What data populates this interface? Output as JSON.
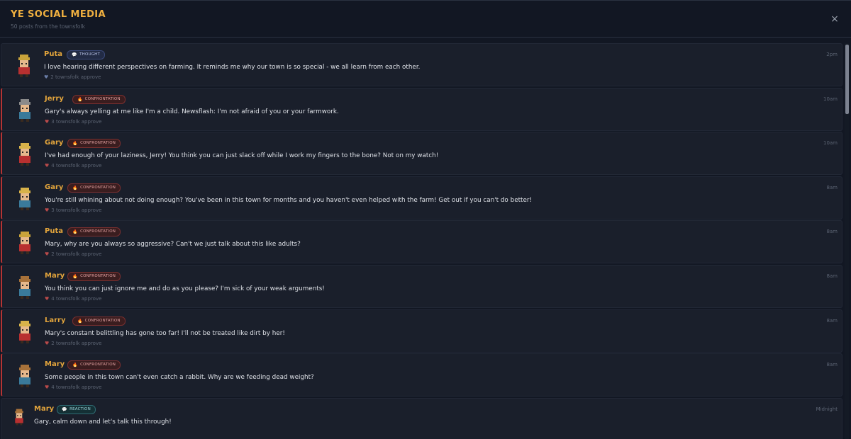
{
  "header": {
    "title": "YE SOCIAL MEDIA",
    "subtitle": "50 posts from the townsfolk",
    "close_icon": "×"
  },
  "posts": [
    {
      "name": "Puta",
      "type": "thought",
      "badge": "THOUGHT",
      "badge_icon": "💬",
      "text": "I love hearing different perspectives on farming. It reminds me why our town is so special - we all learn from each other.",
      "likes": "2 townsfolk approve",
      "time": "2pm",
      "avatar_color": "#c9a33a"
    },
    {
      "name": "Jerry",
      "type": "confrontation",
      "badge": "CONFRONTATION",
      "badge_icon": "🔥",
      "text": "Gary's always yelling at me like I'm a child. Newsflash: I'm not afraid of you or your farmwork.",
      "likes": "3 townsfolk approve",
      "time": "10am",
      "avatar_color": "#8a8a8a"
    },
    {
      "name": "Gary",
      "type": "confrontation",
      "badge": "CONFRONTATION",
      "badge_icon": "🔥",
      "text": "I've had enough of your laziness, Jerry! You think you can just slack off while I work my fingers to the bone? Not on my watch!",
      "likes": "4 townsfolk approve",
      "time": "10am",
      "avatar_color": "#d8b24a"
    },
    {
      "name": "Gary",
      "type": "confrontation",
      "badge": "CONFRONTATION",
      "badge_icon": "🔥",
      "text": "You're still whining about not doing enough? You've been in this town for months and you haven't even helped with the farm! Get out if you can't do better!",
      "likes": "3 townsfolk approve",
      "time": "8am",
      "avatar_color": "#d8b24a"
    },
    {
      "name": "Puta",
      "type": "confrontation",
      "badge": "CONFRONTATION",
      "badge_icon": "🔥",
      "text": "Mary, why are you always so aggressive? Can't we just talk about this like adults?",
      "likes": "2 townsfolk approve",
      "time": "8am",
      "avatar_color": "#c9a33a"
    },
    {
      "name": "Mary",
      "type": "confrontation",
      "badge": "CONFRONTATION",
      "badge_icon": "🔥",
      "text": "You think you can just ignore me and do as you please? I'm sick of your weak arguments!",
      "likes": "4 townsfolk approve",
      "time": "8am",
      "avatar_color": "#a8723a"
    },
    {
      "name": "Larry",
      "type": "confrontation",
      "badge": "CONFRONTATION",
      "badge_icon": "🔥",
      "text": "Mary's constant belittling has gone too far! I'll not be treated like dirt by her!",
      "likes": "2 townsfolk approve",
      "time": "8am",
      "avatar_color": "#d8b24a"
    },
    {
      "name": "Mary",
      "type": "confrontation",
      "badge": "CONFRONTATION",
      "badge_icon": "🔥",
      "text": "Some people in this town can't even catch a rabbit. Why are we feeding dead weight?",
      "likes": "4 townsfolk approve",
      "time": "8am",
      "avatar_color": "#a8723a"
    },
    {
      "name": "Mary",
      "type": "reaction",
      "badge": "REACTION",
      "badge_icon": "💬",
      "text": "Gary, calm down and let's talk this through!",
      "likes": "",
      "time": "Midnight",
      "avatar_color": "#a8723a"
    }
  ],
  "colors": {
    "accent": "#f0b040",
    "name": "#e3a53c",
    "confrontation_border": "#b63434"
  }
}
